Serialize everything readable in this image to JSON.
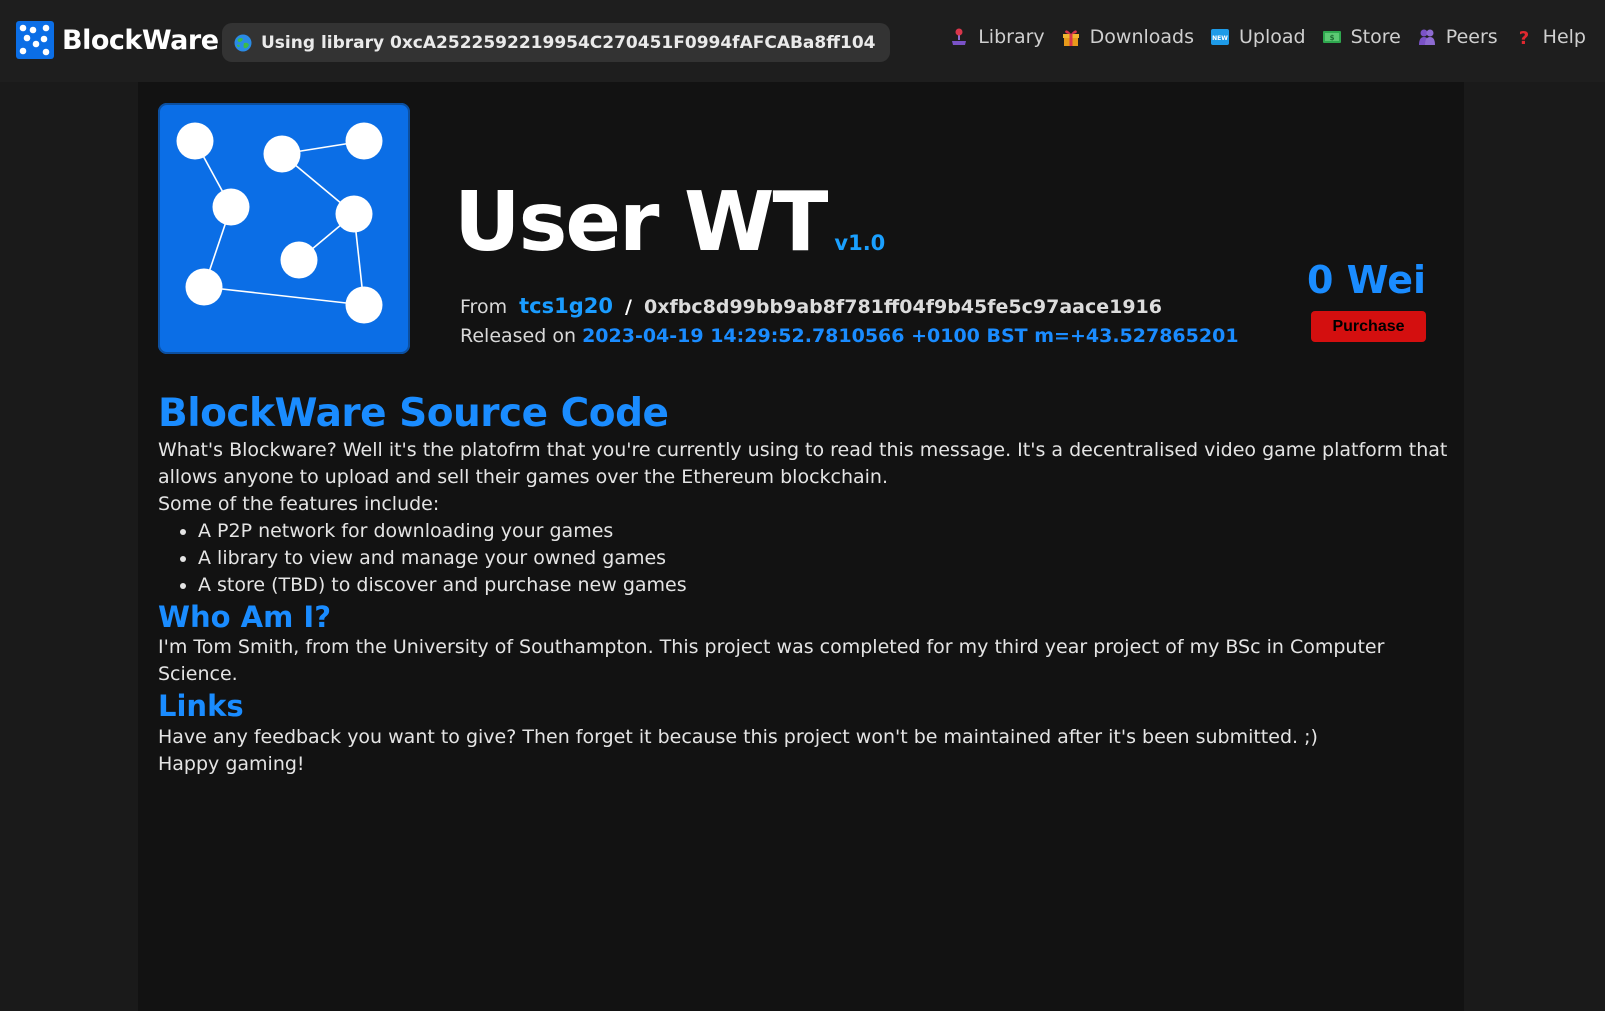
{
  "brand": {
    "name": "BlockWare"
  },
  "library_pill": {
    "label": "Using library 0xcA2522592219954C270451F0994fAFCABa8ff104"
  },
  "nav": {
    "items": [
      {
        "label": "Library",
        "icon": "joystick-icon"
      },
      {
        "label": "Downloads",
        "icon": "gift-icon"
      },
      {
        "label": "Upload",
        "icon": "new-icon"
      },
      {
        "label": "Store",
        "icon": "money-icon"
      },
      {
        "label": "Peers",
        "icon": "people-icon"
      },
      {
        "label": "Help",
        "icon": "question-icon"
      }
    ]
  },
  "game": {
    "title": "User WT",
    "version": "v1.0",
    "from_label": "From",
    "author": "tcs1g20",
    "separator": "/",
    "address": "0xfbc8d99bb9ab8f781ff04f9b45fe5c97aace1916",
    "released_label": "Released on",
    "released_date": "2023-04-19 14:29:52.7810566 +0100 BST m=+43.527865201",
    "price": "0 Wei",
    "purchase_label": "Purchase"
  },
  "description": {
    "heading": "BlockWare Source Code",
    "intro_1": "What's Blockware? Well it's the platofrm that you're currently using to read this message. It's a decentralised video game platform that allows anyone to upload and sell their games over the Ethereum blockchain.",
    "intro_2": "Some of the features include:",
    "features": [
      "A P2P network for downloading your games",
      "A library to view and manage your owned games",
      "A store (TBD) to discover and purchase new games"
    ],
    "who_heading": "Who Am I?",
    "who_text": "I'm Tom Smith, from the University of Southampton. This project was completed for my third year project of my BSc in Computer Science.",
    "links_heading": "Links",
    "links_text_1": "Have any feedback you want to give? Then forget it because this project won't be maintained after it's been submitted. ;)",
    "links_text_2": "Happy gaming!"
  },
  "colors": {
    "accent": "#1a8cff",
    "purchase": "#d40f0f",
    "icon_bg": "#0b6ee6",
    "background": "#121212",
    "topbar": "#1e1e1e"
  }
}
